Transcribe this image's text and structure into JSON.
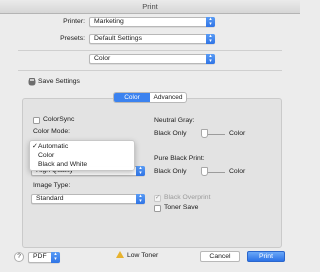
{
  "window": {
    "title": "Print"
  },
  "header": {
    "printer": {
      "label": "Printer:",
      "value": "Marketing"
    },
    "presets": {
      "label": "Presets:",
      "value": "Default Settings"
    },
    "section": {
      "value": "Color"
    }
  },
  "save_settings": {
    "label": "Save Settings"
  },
  "tabs": [
    {
      "label": "Color",
      "active": true
    },
    {
      "label": "Advanced",
      "active": false
    }
  ],
  "left": {
    "colorsync_label": "ColorSync",
    "color_mode_label": "Color Mode:",
    "color_mode_options": [
      {
        "label": "Automatic",
        "checked": true
      },
      {
        "label": "Color",
        "checked": false
      },
      {
        "label": "Black and White",
        "checked": false
      }
    ],
    "quality_value": "High Quality",
    "image_type_label": "Image Type:",
    "image_type_value": "Standard"
  },
  "right": {
    "neutral_gray_label": "Neutral Gray:",
    "neutral_gray_left": "Black Only",
    "neutral_gray_right": "Color",
    "pure_black_label": "Pure Black Print:",
    "pure_black_left": "Black Only",
    "pure_black_right": "Color",
    "black_overprint_label": "Black Overprint",
    "toner_save_label": "Toner Save"
  },
  "footer": {
    "help_label": "?",
    "pdf_label": "PDF",
    "low_toner_label": "Low Toner",
    "cancel_label": "Cancel",
    "print_label": "Print"
  },
  "colors": {
    "accent": "#3b82ef",
    "window_bg": "#ececec",
    "panel_bg": "#e3e3e3",
    "warning": "#e7b22e"
  }
}
